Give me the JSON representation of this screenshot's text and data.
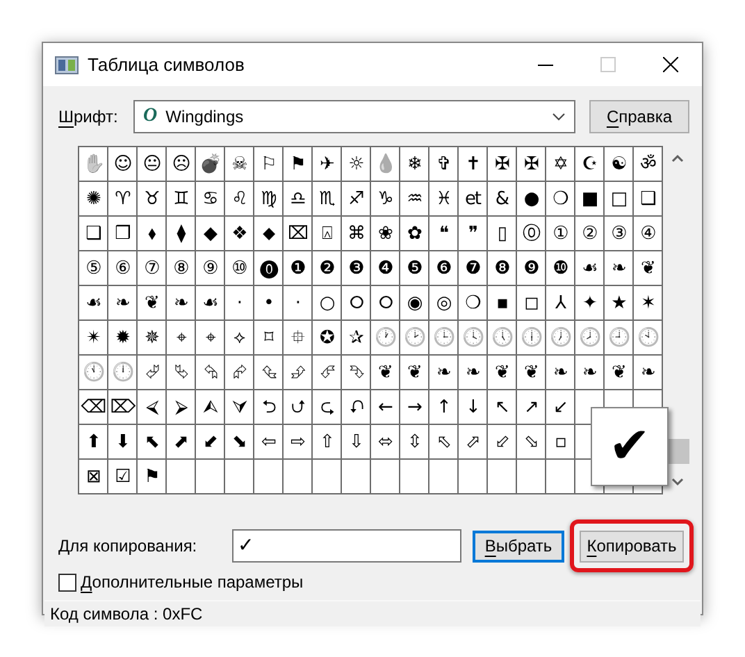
{
  "window": {
    "title": "Таблица символов",
    "maximize_disabled": true
  },
  "font": {
    "label": "Шрифт:",
    "label_mnemonic": true,
    "value": "Wingdings",
    "font_icon": "O"
  },
  "help_button": {
    "label": "Справка",
    "mnemonic": true
  },
  "grid": {
    "rows": [
      [
        "✋",
        "☺",
        "😐",
        "☹",
        "💣",
        "☠",
        "⚐",
        "⚑",
        "✈",
        "☼",
        "💧",
        "❄",
        "✞",
        "✝",
        "✠",
        "✠",
        "✡",
        "☪",
        "☯",
        "ॐ"
      ],
      [
        "✺",
        "♈",
        "♉",
        "♊",
        "♋",
        "♌",
        "♍",
        "♎",
        "♏",
        "♐",
        "♑",
        "♒",
        "♓",
        "et",
        "&",
        "●",
        "❍",
        "■",
        "□",
        "❑"
      ],
      [
        "❑",
        "❒",
        "⬧",
        "⧫",
        "◆",
        "❖",
        "⬥",
        "⌧",
        "⍓",
        "⌘",
        "❀",
        "✿",
        "❝",
        "❞",
        "▯",
        "⓪",
        "①",
        "②",
        "③",
        "④"
      ],
      [
        "⑤",
        "⑥",
        "⑦",
        "⑧",
        "⑨",
        "⑩",
        "⓿",
        "❶",
        "❷",
        "❸",
        "❹",
        "❺",
        "❻",
        "❼",
        "❽",
        "❾",
        "❿",
        "☙",
        "❧",
        "❦"
      ],
      [
        "☙",
        "❧",
        "❦",
        "❧",
        "☙",
        "·",
        "•",
        "·",
        "○",
        "⭘",
        "⭘",
        "◉",
        "◎",
        "❍",
        "▪",
        "◻",
        "⅄",
        "✦",
        "★",
        "✶"
      ],
      [
        "✴",
        "✹",
        "✵",
        "⌖",
        "⌖",
        "⟡",
        "⌑",
        "⯐",
        "✪",
        "✰",
        "🕐",
        "🕑",
        "🕒",
        "🕓",
        "🕔",
        "🕕",
        "🕖",
        "🕗",
        "🕘",
        "🕙"
      ],
      [
        "🕚",
        "🕛",
        "⮰",
        "⮱",
        "⮲",
        "⮳",
        "⮴",
        "⮵",
        "⮶",
        "⮷",
        "❦",
        "❦",
        "❧",
        "❧",
        "❦",
        "❦",
        "❧",
        "❧",
        "❦",
        "❧"
      ],
      [
        "⌫",
        "⌦",
        "⮘",
        "⮚",
        "⮙",
        "⮛",
        "⮌",
        "⮍",
        "⮎",
        "⮏",
        "←",
        "→",
        "↑",
        "↓",
        "↖",
        "↗",
        "↙"
      ],
      [
        "⬆",
        "⬇",
        "⬉",
        "⬈",
        "⬋",
        "⬊",
        "⇦",
        "⇨",
        "⇧",
        "⇩",
        "⬄",
        "⇳",
        "⬁",
        "⬀",
        "⬃",
        "⬂",
        "▫"
      ],
      [
        "⊠",
        "☑",
        "⚑"
      ]
    ]
  },
  "magnified": {
    "glyph": "✔"
  },
  "copy_field": {
    "label": "Для копирования:",
    "value": "✓"
  },
  "select_button": {
    "label": "Выбрать",
    "mnemonic": true,
    "focused": true
  },
  "copy_button": {
    "label": "Копировать",
    "mnemonic": true,
    "highlighted": true
  },
  "advanced": {
    "label": "Дополнительные параметры",
    "mnemonic": true,
    "checked": false
  },
  "status_bar": "Код символа : 0xFC"
}
